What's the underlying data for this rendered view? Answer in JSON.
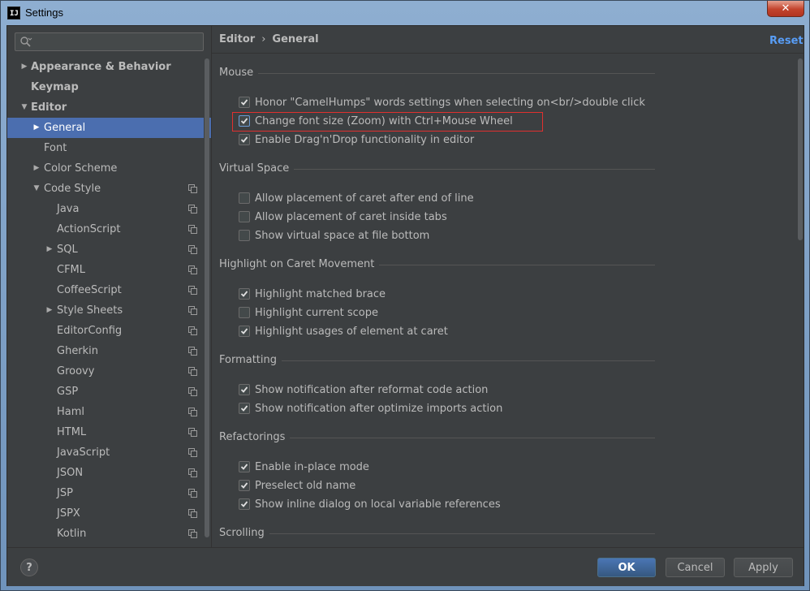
{
  "window": {
    "title": "Settings",
    "app_icon_text": "IJ",
    "close_glyph": "✕"
  },
  "search": {
    "placeholder": "",
    "value": ""
  },
  "sidebar": {
    "items": [
      {
        "label": "Appearance & Behavior",
        "arrow": "▶",
        "level": 0,
        "bold": true,
        "copy": false,
        "selected": false
      },
      {
        "label": "Keymap",
        "arrow": "",
        "level": 0,
        "bold": true,
        "copy": false,
        "selected": false
      },
      {
        "label": "Editor",
        "arrow": "▼",
        "level": 0,
        "bold": true,
        "copy": false,
        "selected": false
      },
      {
        "label": "General",
        "arrow": "▶",
        "level": 1,
        "bold": false,
        "copy": false,
        "selected": true
      },
      {
        "label": "Font",
        "arrow": "",
        "level": 1,
        "bold": false,
        "copy": false,
        "selected": false
      },
      {
        "label": "Color Scheme",
        "arrow": "▶",
        "level": 1,
        "bold": false,
        "copy": false,
        "selected": false
      },
      {
        "label": "Code Style",
        "arrow": "▼",
        "level": 1,
        "bold": false,
        "copy": true,
        "selected": false
      },
      {
        "label": "Java",
        "arrow": "",
        "level": 2,
        "bold": false,
        "copy": true,
        "selected": false
      },
      {
        "label": "ActionScript",
        "arrow": "",
        "level": 2,
        "bold": false,
        "copy": true,
        "selected": false
      },
      {
        "label": "SQL",
        "arrow": "▶",
        "level": 2,
        "bold": false,
        "copy": true,
        "selected": false
      },
      {
        "label": "CFML",
        "arrow": "",
        "level": 2,
        "bold": false,
        "copy": true,
        "selected": false
      },
      {
        "label": "CoffeeScript",
        "arrow": "",
        "level": 2,
        "bold": false,
        "copy": true,
        "selected": false
      },
      {
        "label": "Style Sheets",
        "arrow": "▶",
        "level": 2,
        "bold": false,
        "copy": true,
        "selected": false
      },
      {
        "label": "EditorConfig",
        "arrow": "",
        "level": 2,
        "bold": false,
        "copy": true,
        "selected": false
      },
      {
        "label": "Gherkin",
        "arrow": "",
        "level": 2,
        "bold": false,
        "copy": true,
        "selected": false
      },
      {
        "label": "Groovy",
        "arrow": "",
        "level": 2,
        "bold": false,
        "copy": true,
        "selected": false
      },
      {
        "label": "GSP",
        "arrow": "",
        "level": 2,
        "bold": false,
        "copy": true,
        "selected": false
      },
      {
        "label": "Haml",
        "arrow": "",
        "level": 2,
        "bold": false,
        "copy": true,
        "selected": false
      },
      {
        "label": "HTML",
        "arrow": "",
        "level": 2,
        "bold": false,
        "copy": true,
        "selected": false
      },
      {
        "label": "JavaScript",
        "arrow": "",
        "level": 2,
        "bold": false,
        "copy": true,
        "selected": false
      },
      {
        "label": "JSON",
        "arrow": "",
        "level": 2,
        "bold": false,
        "copy": true,
        "selected": false
      },
      {
        "label": "JSP",
        "arrow": "",
        "level": 2,
        "bold": false,
        "copy": true,
        "selected": false
      },
      {
        "label": "JSPX",
        "arrow": "",
        "level": 2,
        "bold": false,
        "copy": true,
        "selected": false
      },
      {
        "label": "Kotlin",
        "arrow": "",
        "level": 2,
        "bold": false,
        "copy": true,
        "selected": false
      }
    ]
  },
  "header": {
    "crumb_root": "Editor",
    "crumb_sep": "›",
    "crumb_leaf": "General",
    "reset_label": "Reset"
  },
  "sections": [
    {
      "title": "Mouse",
      "options": [
        {
          "label": "Honor \"CamelHumps\" words settings when selecting on<br/>double click",
          "checked": true
        },
        {
          "label": "Change font size (Zoom) with Ctrl+Mouse Wheel",
          "checked": true,
          "highlighted": true
        },
        {
          "label": "Enable Drag'n'Drop functionality in editor",
          "checked": true
        }
      ]
    },
    {
      "title": "Virtual Space",
      "options": [
        {
          "label": "Allow placement of caret after end of line",
          "checked": false
        },
        {
          "label": "Allow placement of caret inside tabs",
          "checked": false
        },
        {
          "label": "Show virtual space at file bottom",
          "checked": false
        }
      ]
    },
    {
      "title": "Highlight on Caret Movement",
      "options": [
        {
          "label": "Highlight matched brace",
          "checked": true
        },
        {
          "label": "Highlight current scope",
          "checked": false
        },
        {
          "label": "Highlight usages of element at caret",
          "checked": true
        }
      ]
    },
    {
      "title": "Formatting",
      "options": [
        {
          "label": "Show notification after reformat code action",
          "checked": true
        },
        {
          "label": "Show notification after optimize imports action",
          "checked": true
        }
      ]
    },
    {
      "title": "Refactorings",
      "options": [
        {
          "label": "Enable in-place mode",
          "checked": true
        },
        {
          "label": "Preselect old name",
          "checked": true
        },
        {
          "label": "Show inline dialog on local variable references",
          "checked": true
        }
      ]
    },
    {
      "title": "Scrolling",
      "options": []
    }
  ],
  "footer": {
    "help_label": "?",
    "ok_label": "OK",
    "cancel_label": "Cancel",
    "apply_label": "Apply"
  },
  "colors": {
    "background": "#3c3f41",
    "selection": "#4b6eaf",
    "link": "#589df6",
    "highlight_border": "#e0302f",
    "primary_button": "#365880"
  }
}
